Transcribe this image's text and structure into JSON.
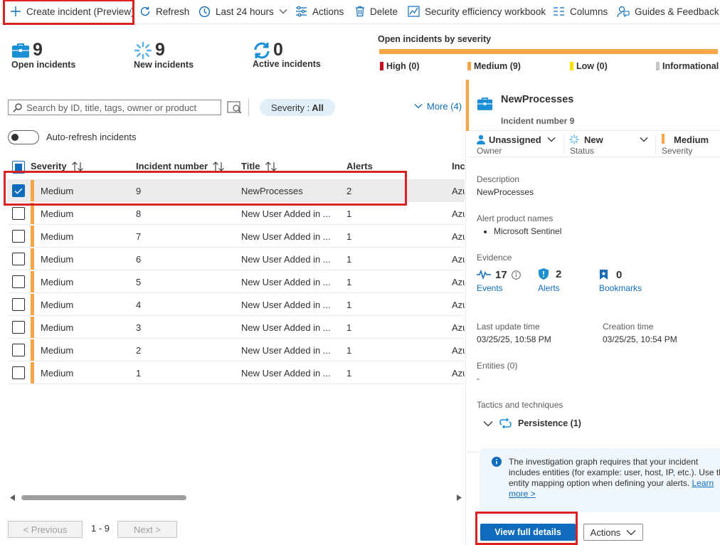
{
  "toolbar": {
    "create_label": "Create incident (Preview)",
    "refresh_label": "Refresh",
    "time_label": "Last 24 hours",
    "actions_label": "Actions",
    "delete_label": "Delete",
    "workbook_label": "Security efficiency workbook",
    "columns_label": "Columns",
    "guides_label": "Guides & Feedback"
  },
  "stats": {
    "open": {
      "value": "9",
      "label": "Open incidents"
    },
    "new": {
      "value": "9",
      "label": "New incidents"
    },
    "active": {
      "value": "0",
      "label": "Active incidents"
    }
  },
  "severity_summary": {
    "title": "Open incidents by severity",
    "legend": [
      {
        "label": "High (0)",
        "color": "#c50f1f"
      },
      {
        "label": "Medium (9)",
        "color": "#f8a548"
      },
      {
        "label": "Low (0)",
        "color": "#fce100"
      },
      {
        "label": "Informational (",
        "color": "#c8c6c4"
      }
    ]
  },
  "filters": {
    "search_placeholder": "Search by ID, title, tags, owner or product",
    "severity_key": "Severity : ",
    "severity_value": "All",
    "more_label": "More (4)",
    "autorefresh_label": "Auto-refresh incidents"
  },
  "table": {
    "headers": {
      "severity": "Severity",
      "number": "Incident number",
      "title": "Title",
      "alerts": "Alerts",
      "next": "Inci"
    },
    "rows": [
      {
        "severity": "Medium",
        "number": "9",
        "title": "NewProcesses",
        "alerts": "2",
        "next": "Azu"
      },
      {
        "severity": "Medium",
        "number": "8",
        "title": "New User Added in ...",
        "alerts": "1",
        "next": "Azu"
      },
      {
        "severity": "Medium",
        "number": "7",
        "title": "New User Added in ...",
        "alerts": "1",
        "next": "Azu"
      },
      {
        "severity": "Medium",
        "number": "6",
        "title": "New User Added in ...",
        "alerts": "1",
        "next": "Azu"
      },
      {
        "severity": "Medium",
        "number": "5",
        "title": "New User Added in ...",
        "alerts": "1",
        "next": "Azu"
      },
      {
        "severity": "Medium",
        "number": "4",
        "title": "New User Added in ...",
        "alerts": "1",
        "next": "Azu"
      },
      {
        "severity": "Medium",
        "number": "3",
        "title": "New User Added in ...",
        "alerts": "1",
        "next": "Azu"
      },
      {
        "severity": "Medium",
        "number": "2",
        "title": "New User Added in ...",
        "alerts": "1",
        "next": "Azu"
      },
      {
        "severity": "Medium",
        "number": "1",
        "title": "New User Added in ...",
        "alerts": "1",
        "next": "Azu"
      }
    ]
  },
  "pagination": {
    "prev": "< Previous",
    "range": "1 - 9",
    "next": "Next >"
  },
  "detail": {
    "title": "NewProcesses",
    "subtitle": "Incident number 9",
    "owner_value": "Unassigned",
    "owner_label": "Owner",
    "status_value": "New",
    "status_label": "Status",
    "severity_value": "Medium",
    "severity_label": "Severity",
    "description_label": "Description",
    "description_value": "NewProcesses",
    "products_label": "Alert product names",
    "product_item": "Microsoft Sentinel",
    "evidence_label": "Evidence",
    "events_count": "17",
    "events_label": "Events",
    "alerts_count": "2",
    "alerts_label": "Alerts",
    "bookmarks_count": "0",
    "bookmarks_label": "Bookmarks",
    "last_update_label": "Last update time",
    "last_update_value": "03/25/25, 10:58 PM",
    "creation_label": "Creation time",
    "creation_value": "03/25/25, 10:54 PM",
    "entities_label": "Entities (0)",
    "entities_value": "-",
    "tactics_label": "Tactics and techniques",
    "tactic_item": "Persistence (1)",
    "info_line1": "The investigation graph requires that your incident",
    "info_line2": "includes entities (for example: user, host, IP, etc.). Use the",
    "info_line3": "entity mapping option when defining your alerts. ",
    "info_link1": "Learn",
    "info_link2": "more >",
    "view_button": "View full details",
    "actions_button": "Actions"
  },
  "colors": {
    "accent": "#0f6cbd",
    "medium": "#f8a548",
    "highlight": "#d92323"
  }
}
